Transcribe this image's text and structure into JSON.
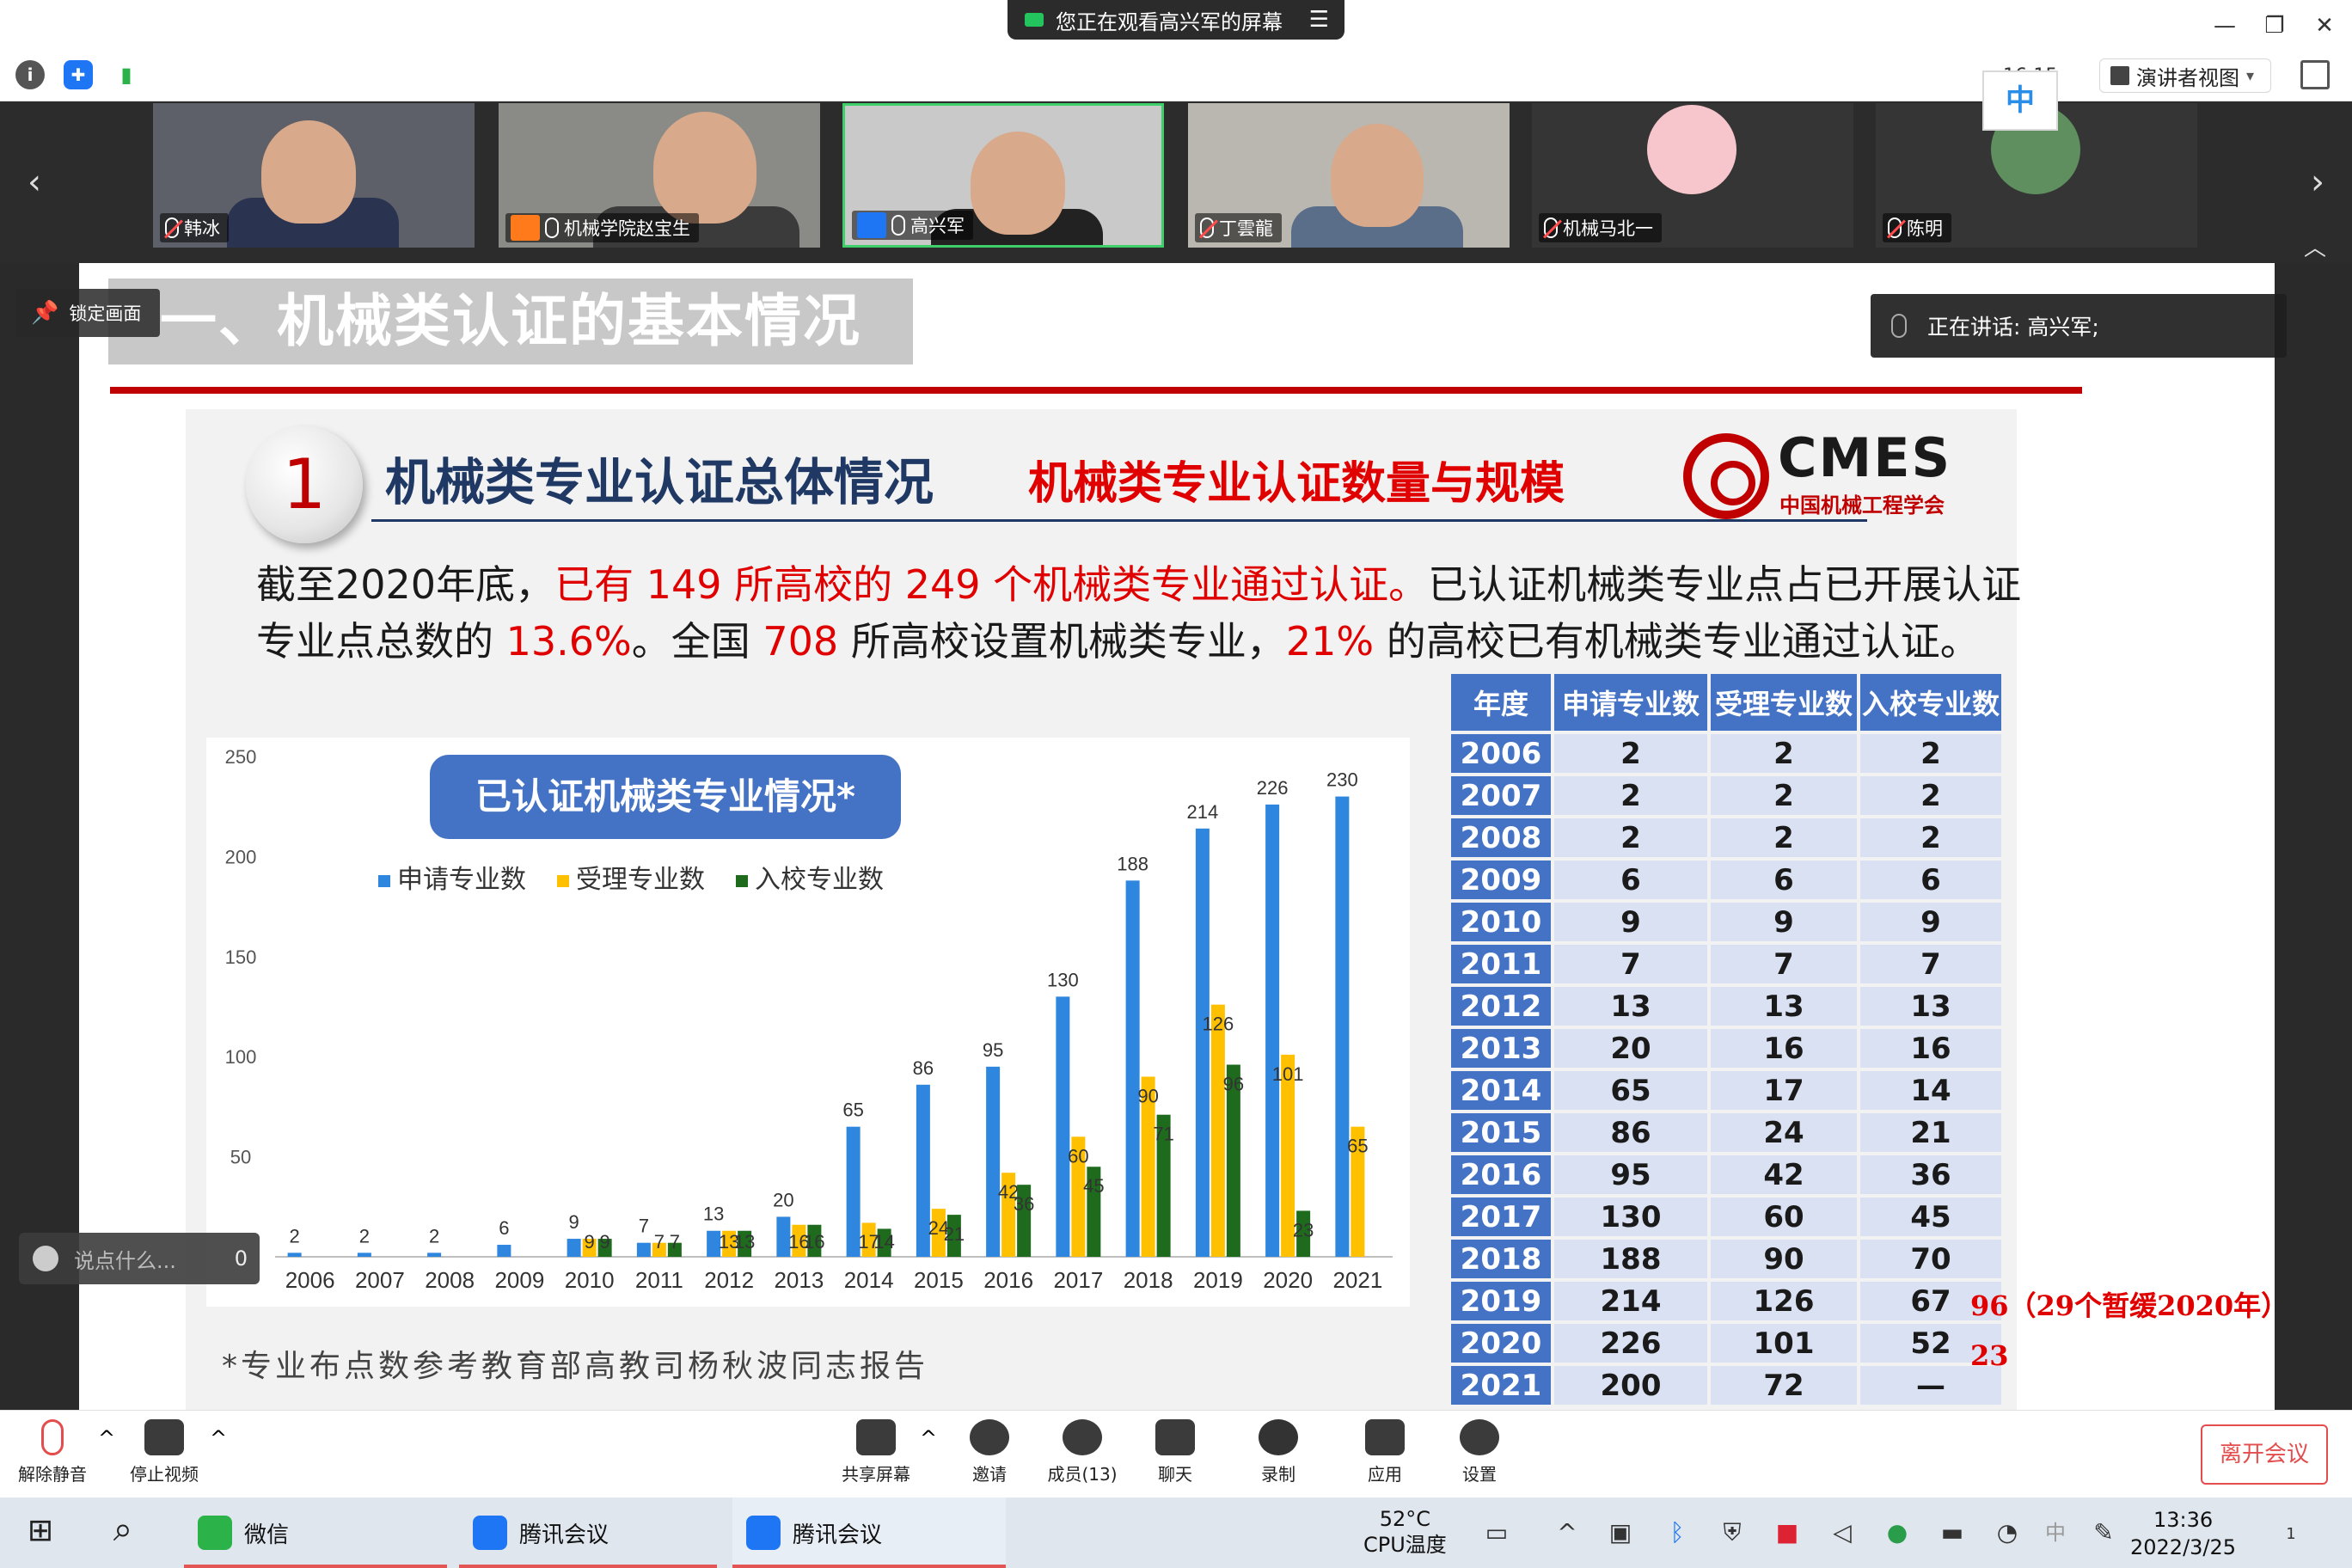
{
  "titlebar": {
    "sharing_text": "您正在观看高兴军的屏幕",
    "menu_glyph": "☰",
    "min_glyph": "—",
    "restore_glyph": "❐",
    "close_glyph": "✕"
  },
  "toolbar": {
    "info_glyph": "i",
    "shield_glyph": "✚",
    "signal_glyph": "▮",
    "time_peek": "16:15",
    "ime_label": "中",
    "presenter_view": "演讲者视图",
    "presenter_caret": "▾"
  },
  "participants": [
    {
      "name": "韩冰"
    },
    {
      "name": "机械学院赵宝生"
    },
    {
      "name": "高兴军"
    },
    {
      "name": "丁雲龍"
    },
    {
      "name": "机械马北一"
    },
    {
      "name": "陈明"
    }
  ],
  "strip_nav": {
    "left": "‹",
    "right": "›",
    "collapse": "︿"
  },
  "overlay": {
    "lock_label": "锁定画面",
    "speaking": "正在讲话: 高兴军;",
    "chat_placeholder": "说点什么...",
    "chat_count": "0"
  },
  "slide": {
    "heading": "一、机械类认证的基本情况",
    "number": "1",
    "subtitle": "机械类专业认证总体情况",
    "subtitle_red": "机械类专业认证数量与规模",
    "cmes_logo": "CMES",
    "cmes_org": "中国机械工程学会",
    "para1_a": "截至2020年底，",
    "para1_b": "已有 149 所高校的 249 个机械类专业通过认证。",
    "para1_c": "已认证机械类专业点占已开展认证",
    "para2_a": "专业点总数的 ",
    "para2_b": "13.6%",
    "para2_c": "。全国 ",
    "para2_d": "708",
    "para2_e": " 所高校设置机械类专业，",
    "para2_f": "21%",
    "para2_g": " 的高校已有机械类专业通过认证。",
    "footnote": "*专业布点数参考教育部高教司杨秋波同志报告"
  },
  "chart_data": {
    "type": "bar",
    "title": "已认证机械类专业情况*",
    "categories": [
      "2006",
      "2007",
      "2008",
      "2009",
      "2010",
      "2011",
      "2012",
      "2013",
      "2014",
      "2015",
      "2016",
      "2017",
      "2018",
      "2019",
      "2020",
      "2021"
    ],
    "series": [
      {
        "name": "申请专业数",
        "color": "#2e86de",
        "values": [
          2,
          2,
          2,
          6,
          9,
          7,
          13,
          20,
          65,
          86,
          95,
          130,
          188,
          214,
          226,
          230
        ]
      },
      {
        "name": "受理专业数",
        "color": "#ffc000",
        "values": [
          0,
          0,
          0,
          0,
          9,
          7,
          13,
          16,
          17,
          24,
          42,
          60,
          90,
          126,
          101,
          65
        ]
      },
      {
        "name": "入校专业数",
        "color": "#1e6b1e",
        "values": [
          0,
          0,
          0,
          0,
          9,
          7,
          13,
          16,
          14,
          21,
          36,
          45,
          71,
          96,
          23,
          0
        ]
      }
    ],
    "labels": {
      "申请专业数": [
        "2",
        "2",
        "2",
        "6",
        "9",
        "7",
        "13",
        "20",
        "65",
        "86",
        "95",
        "130",
        "188",
        "214",
        "226",
        "230"
      ],
      "受理专业数": [
        "",
        "",
        "",
        "",
        "9",
        "7",
        "13",
        "16",
        "17",
        "24",
        "42",
        "60",
        "90",
        "126",
        "101",
        "65"
      ],
      "入校专业数": [
        "",
        "",
        "",
        "",
        "9",
        "7",
        "13",
        "16",
        "14",
        "21",
        "36",
        "45",
        "71",
        "96",
        "23",
        ""
      ]
    },
    "yticks": [
      "50",
      "100",
      "150",
      "200",
      "250"
    ],
    "ylim": [
      0,
      250
    ],
    "grid": false,
    "legend": "top-left"
  },
  "table": {
    "headers": [
      "年度",
      "申请专业数",
      "受理专业数",
      "入校专业数"
    ],
    "rows": [
      [
        "2006",
        "2",
        "2",
        "2"
      ],
      [
        "2007",
        "2",
        "2",
        "2"
      ],
      [
        "2008",
        "2",
        "2",
        "2"
      ],
      [
        "2009",
        "6",
        "6",
        "6"
      ],
      [
        "2010",
        "9",
        "9",
        "9"
      ],
      [
        "2011",
        "7",
        "7",
        "7"
      ],
      [
        "2012",
        "13",
        "13",
        "13"
      ],
      [
        "2013",
        "20",
        "16",
        "16"
      ],
      [
        "2014",
        "65",
        "17",
        "14"
      ],
      [
        "2015",
        "86",
        "24",
        "21"
      ],
      [
        "2016",
        "95",
        "42",
        "36"
      ],
      [
        "2017",
        "130",
        "60",
        "45"
      ],
      [
        "2018",
        "188",
        "90",
        "70"
      ],
      [
        "2019",
        "214",
        "126",
        "67"
      ],
      [
        "2020",
        "226",
        "101",
        "52"
      ],
      [
        "2021",
        "200",
        "72",
        "—"
      ]
    ],
    "note_2019_num": "96",
    "note_2019_text": "（29个暂缓2020年）",
    "note_2020_num": "23"
  },
  "controls": {
    "unmute": "解除静音",
    "stop_video": "停止视频",
    "share": "共享屏幕",
    "invite": "邀请",
    "members": "成员(13)",
    "chat": "聊天",
    "record": "录制",
    "apps": "应用",
    "settings": "设置",
    "leave": "离开会议",
    "caret": "^"
  },
  "taskbar": {
    "start": "⊞",
    "search": "⌕",
    "wechat": "微信",
    "tencent1": "腾讯会议",
    "tencent2": "腾讯会议",
    "temp": "52°C",
    "temp_label": "CPU温度",
    "time": "13:36",
    "date": "2022/3/25",
    "ime": "中",
    "notify_count": "1"
  }
}
